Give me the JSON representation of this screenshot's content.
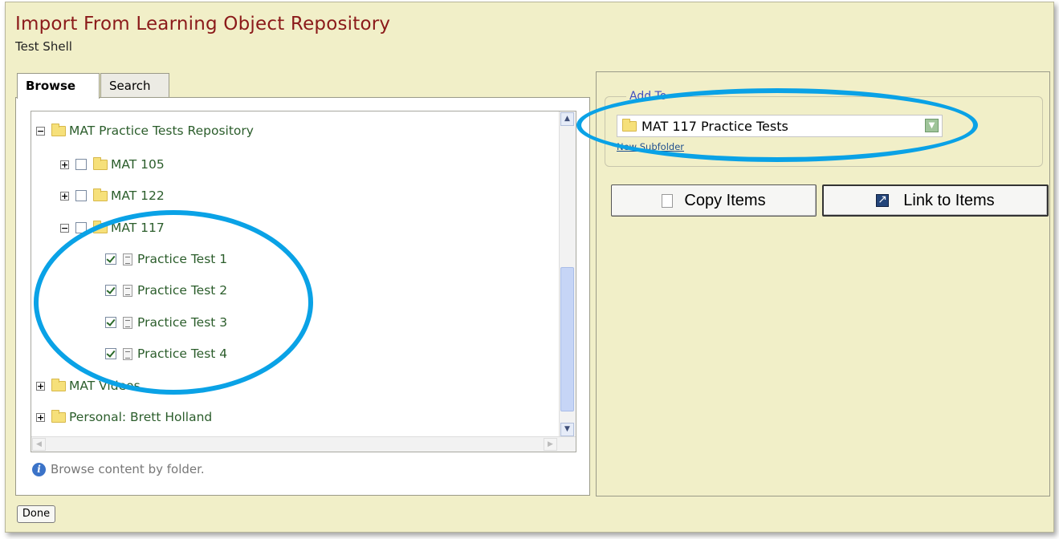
{
  "header": {
    "title": "Import From Learning Object Repository",
    "subtitle": "Test Shell"
  },
  "tabs": [
    {
      "label": "Browse",
      "active": true
    },
    {
      "label": "Search",
      "active": false
    }
  ],
  "tree": {
    "items": [
      {
        "label": "MAT Practice Tests Repository",
        "expander": "−"
      },
      {
        "label": "MAT 105",
        "expander": "+"
      },
      {
        "label": "MAT 122",
        "expander": "+"
      },
      {
        "label": "MAT 117",
        "expander": "−"
      },
      {
        "label": "Practice Test 1",
        "checked": true
      },
      {
        "label": "Practice Test 2",
        "checked": true
      },
      {
        "label": "Practice Test 3",
        "checked": true
      },
      {
        "label": "Practice Test 4",
        "checked": true
      },
      {
        "label": "MAT Videos",
        "expander": "+"
      },
      {
        "label": "Personal: Brett Holland",
        "expander": "+"
      }
    ]
  },
  "info_text": "Browse content by folder.",
  "done_label": "Done",
  "add_to": {
    "legend": "Add To",
    "selected": "MAT 117 Practice Tests",
    "new_subfolder": "New Subfolder"
  },
  "buttons": {
    "copy": "Copy Items",
    "link": "Link to Items"
  },
  "colors": {
    "title": "#8b1a1a",
    "background": "#f1efc8",
    "tree_text": "#2b5d2b",
    "annotation": "#0aa2e6"
  }
}
